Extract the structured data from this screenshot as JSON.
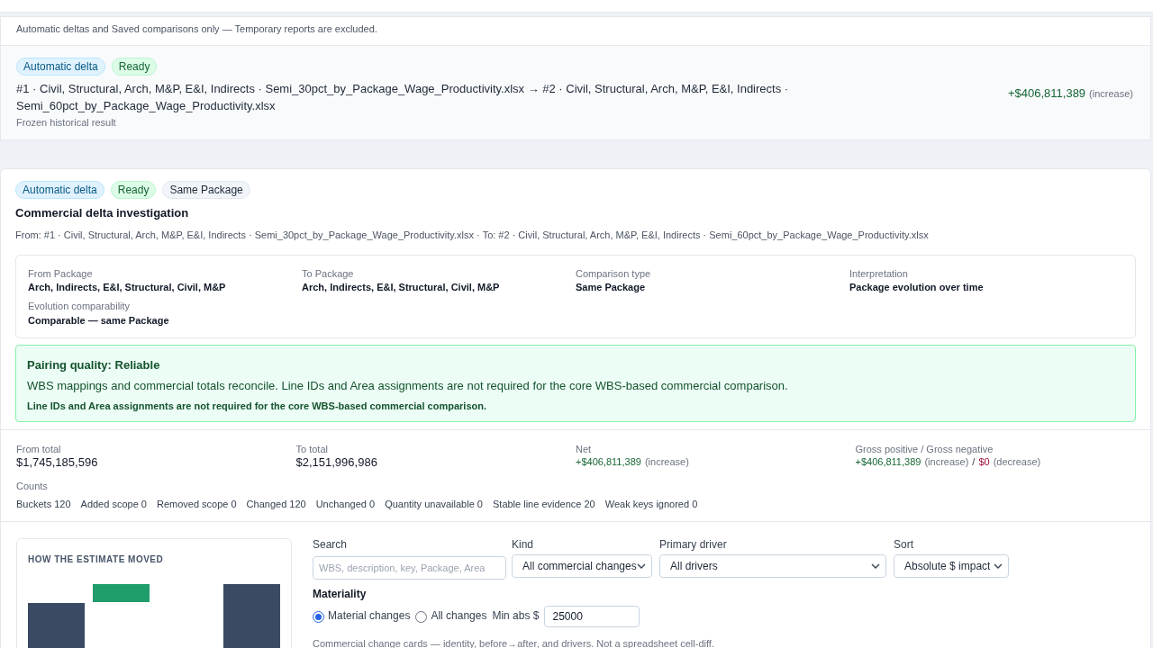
{
  "history": {
    "note": "Automatic deltas and Saved comparisons only — Temporary reports are excluded.",
    "items": [
      {
        "badges": [
          {
            "label": "Automatic delta",
            "kind": "info"
          },
          {
            "label": "Ready",
            "kind": "success"
          }
        ],
        "title": "#1 · Civil, Structural, Arch, M&P, E&I, Indirects · Semi_30pct_by_Package_Wage_Productivity.xlsx → #2 · Civil, Structural, Arch, M&P, E&I, Indirects · Semi_60pct_by_Package_Wage_Productivity.xlsx",
        "subtitle": "Frozen historical result",
        "amount": "+$406,811,389",
        "amount_note": "(increase)"
      }
    ]
  },
  "investigation": {
    "badges": [
      {
        "label": "Automatic delta",
        "kind": "info"
      },
      {
        "label": "Ready",
        "kind": "success"
      },
      {
        "label": "Same Package",
        "kind": "neutral"
      }
    ],
    "title": "Commercial delta investigation",
    "route": "From: #1 · Civil, Structural, Arch, M&P, E&I, Indirects · Semi_30pct_by_Package_Wage_Productivity.xlsx · To: #2 · Civil, Structural, Arch, M&P, E&I, Indirects · Semi_60pct_by_Package_Wage_Productivity.xlsx",
    "facts": [
      {
        "label": "From Package",
        "value": "Arch, Indirects, E&I, Structural, Civil, M&P"
      },
      {
        "label": "To Package",
        "value": "Arch, Indirects, E&I, Structural, Civil, M&P"
      },
      {
        "label": "Comparison type",
        "value": "Same Package"
      },
      {
        "label": "Interpretation",
        "value": "Package evolution over time"
      },
      {
        "label": "Evolution comparability",
        "value": "Comparable — same Package"
      }
    ],
    "quality": {
      "title": "Pairing quality: Reliable",
      "text": "WBS mappings and commercial totals reconcile. Line IDs and Area assignments are not required for the core WBS-based commercial comparison.",
      "note": "Line IDs and Area assignments are not required for the core WBS-based commercial comparison."
    },
    "totals": {
      "from": {
        "label": "From total",
        "value": "$1,745,185,596"
      },
      "to": {
        "label": "To total",
        "value": "$2,151,996,986"
      },
      "net": {
        "label": "Net",
        "amount": "+$406,811,389",
        "note": "(increase)"
      },
      "gross": {
        "label": "Gross positive / Gross negative",
        "positive": "+$406,811,389",
        "positive_note": "(increase)",
        "separator": "/",
        "negative": "$0",
        "negative_note": "(decrease)"
      }
    },
    "counts": {
      "label": "Counts",
      "items": [
        "Buckets 120",
        "Added scope 0",
        "Removed scope 0",
        "Changed 120",
        "Unchanged 0",
        "Quantity unavailable 0",
        "Stable line evidence 20",
        "Weak keys ignored 0"
      ]
    },
    "chart": {
      "title": "HOW THE ESTIMATE MOVED"
    },
    "filters": {
      "search": {
        "label": "Search",
        "placeholder": "WBS, description, key, Package, Area"
      },
      "kind": {
        "label": "Kind",
        "value": "All commercial changes"
      },
      "driver": {
        "label": "Primary driver",
        "value": "All drivers"
      },
      "sort": {
        "label": "Sort",
        "value": "Absolute $ impact"
      },
      "materiality": {
        "label": "Materiality",
        "options": [
          {
            "label": "Material changes",
            "selected": true
          },
          {
            "label": "All changes",
            "selected": false
          }
        ],
        "min_label": "Min abs $",
        "min_value": "25000"
      },
      "caption": "Commercial change cards — identity, before→after, and drivers. Not a spreadsheet cell-diff."
    }
  }
}
